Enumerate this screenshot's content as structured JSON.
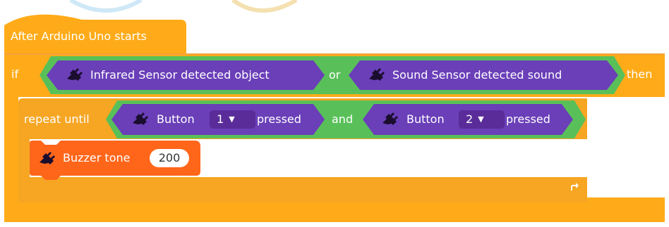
{
  "hat_block": {
    "label": "After Arduino Uno starts"
  },
  "if_block": {
    "if_label": "if",
    "then_label": "then",
    "condition": {
      "operator": "or",
      "left": {
        "label": "Infrared Sensor detected object"
      },
      "right": {
        "label": "Sound Sensor detected sound"
      }
    }
  },
  "repeat_block": {
    "label": "repeat until",
    "condition": {
      "operator": "and",
      "left": {
        "prefix": "Button",
        "value": "1",
        "suffix": "pressed"
      },
      "right": {
        "prefix": "Button",
        "value": "2",
        "suffix": "pressed"
      }
    },
    "loop_arrow": "loop-arrow-icon"
  },
  "buzzer_block": {
    "label": "Buzzer tone",
    "value": "200"
  },
  "colors": {
    "events": "#FFAB19",
    "control": "#FFAB19",
    "sensing": "#6A3FB8",
    "operator": "#59C059",
    "actuator": "#FF6B1A"
  },
  "icons": [
    "arduino-plug-icon",
    "dropdown-arrow-icon",
    "loop-arrow-icon"
  ]
}
